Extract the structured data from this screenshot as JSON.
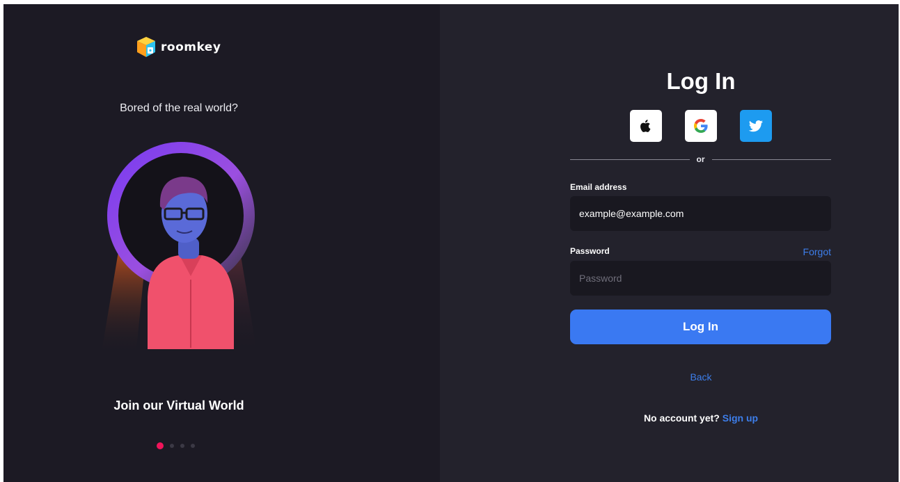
{
  "brand": {
    "name": "roomkey"
  },
  "left_panel": {
    "tagline": "Bored of the real world?",
    "caption": "Join our Virtual World",
    "carousel": {
      "count": 4,
      "active_index": 0
    }
  },
  "login": {
    "title": "Log In",
    "social": [
      {
        "provider": "apple",
        "icon": "apple-icon"
      },
      {
        "provider": "google",
        "icon": "google-icon"
      },
      {
        "provider": "twitter",
        "icon": "twitter-icon"
      }
    ],
    "divider_text": "or",
    "email": {
      "label": "Email address",
      "value": "example@example.com",
      "placeholder": ""
    },
    "password": {
      "label": "Password",
      "value": "",
      "placeholder": "Password",
      "forgot_label": "Forgot"
    },
    "submit_label": "Log In",
    "back_label": "Back",
    "signup_prompt": "No account yet?",
    "signup_link": "Sign up"
  },
  "colors": {
    "left_bg": "#1c1a24",
    "right_bg": "#23222c",
    "field_bg": "#191820",
    "accent_blue": "#3a79f2",
    "link_blue": "#3d7eea",
    "twitter_blue": "#1d9bf0",
    "carousel_active": "#f0145a"
  }
}
